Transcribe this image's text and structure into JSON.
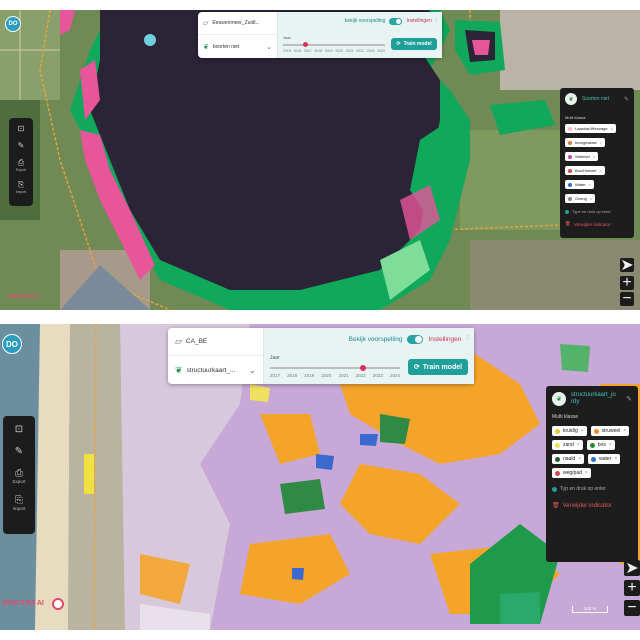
{
  "screens": [
    {
      "avatar": "DO",
      "dataset": "Eeuwenmeer_Zuidl...",
      "model": "boorten niet",
      "forecast_label": "bekijk voorspelling",
      "settings_label": "Instellingen",
      "slider_label": "Jaar",
      "years": [
        "2015",
        "2016",
        "2017",
        "2018",
        "2019",
        "2020",
        "2021",
        "2022",
        "2023",
        "2024"
      ],
      "selected_year": "2017",
      "train_label": "Train model",
      "tools": [
        {
          "icon": "select-icon",
          "glyph": "⊡",
          "label": ""
        },
        {
          "icon": "draw-icon",
          "glyph": "✎",
          "label": ""
        },
        {
          "icon": "export-icon",
          "glyph": "⎙",
          "label": "Export"
        },
        {
          "icon": "import-icon",
          "glyph": "⎘",
          "label": "Import"
        }
      ],
      "panel": {
        "title": "Soorten niet",
        "subtitle": "Multi klasse",
        "classes": [
          {
            "label": "Laanrlar/Wenzage",
            "color": "#f6b8c8"
          },
          {
            "label": "boorgewlast",
            "color": "#e07a3a"
          },
          {
            "label": "Waterlet",
            "color": "#c84aa8"
          },
          {
            "label": "Bos/Hoewel",
            "color": "#d94a4a"
          },
          {
            "label": "Water",
            "color": "#2a6fd0"
          },
          {
            "label": "Overig",
            "color": "#888888"
          }
        ],
        "input_placeholder": "Type en druk op enter",
        "delete_label": "Verwijder indicator"
      },
      "brand": "SPECTRA AI"
    },
    {
      "avatar": "DO",
      "dataset": "CA_BE",
      "model": "structuurkaart_...",
      "forecast_label": "Bekijk voorspelling",
      "settings_label": "Instellingen",
      "slider_label": "Jaar",
      "years": [
        "2017",
        "2018",
        "2019",
        "2020",
        "2021",
        "2022",
        "2023",
        "2024"
      ],
      "selected_year": "2022",
      "train_label": "Train model",
      "tools": [
        {
          "icon": "select-icon",
          "glyph": "⊡",
          "label": ""
        },
        {
          "icon": "draw-icon",
          "glyph": "✎",
          "label": ""
        },
        {
          "icon": "export-icon",
          "glyph": "⎙",
          "label": "Export"
        },
        {
          "icon": "import-icon",
          "glyph": "⎘",
          "label": "Import"
        }
      ],
      "panel": {
        "title": "structuurkaart_jo rdy",
        "subtitle": "Multi klasse",
        "classes": [
          {
            "label": "kruidig",
            "color": "#e8c83a"
          },
          {
            "label": "struweel",
            "color": "#f08a2a"
          },
          {
            "label": "zand",
            "color": "#f0e060"
          },
          {
            "label": "bos",
            "color": "#2a8a3a"
          },
          {
            "label": "naald",
            "color": "#205a30"
          },
          {
            "label": "water",
            "color": "#2a6fd0"
          },
          {
            "label": "weg/pad",
            "color": "#d94a4a"
          }
        ],
        "input_placeholder": "Typ en druk op enter",
        "delete_label": "Verwijder indicator"
      },
      "brand": "SPECTRA AI",
      "scale_label": "100 m"
    }
  ]
}
